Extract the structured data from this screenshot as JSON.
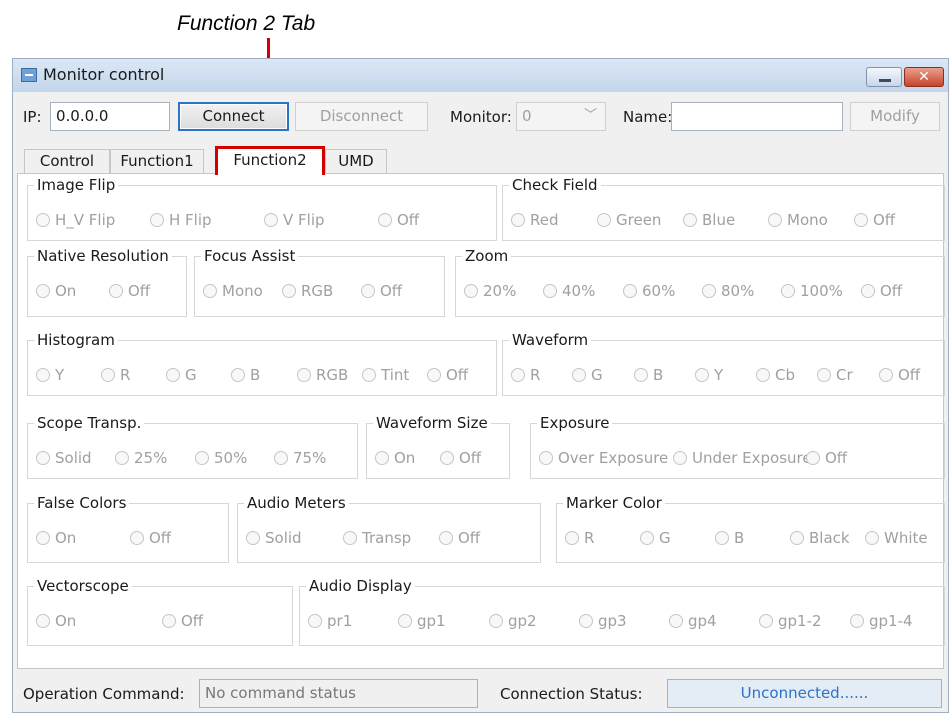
{
  "annotation": {
    "label": "Function 2 Tab"
  },
  "window": {
    "title": "Monitor control",
    "close_glyph": "✕"
  },
  "toolbar": {
    "ip_label": "IP:",
    "ip_value": "0.0.0.0",
    "connect_label": "Connect",
    "disconnect_label": "Disconnect",
    "monitor_label": "Monitor:",
    "monitor_value": "0",
    "name_label": "Name:",
    "name_value": "",
    "modify_label": "Modify"
  },
  "tabs": [
    "Control",
    "Function1",
    "Function2",
    "UMD"
  ],
  "active_tab": "Function2",
  "groups": [
    {
      "id": "image-flip",
      "label": "Image Flip",
      "options": [
        "H_V Flip",
        "H Flip",
        "V Flip",
        "Off"
      ]
    },
    {
      "id": "check-field",
      "label": "Check Field",
      "options": [
        "Red",
        "Green",
        "Blue",
        "Mono",
        "Off"
      ]
    },
    {
      "id": "native-resolution",
      "label": "Native Resolution",
      "options": [
        "On",
        "Off"
      ]
    },
    {
      "id": "focus-assist",
      "label": "Focus Assist",
      "options": [
        "Mono",
        "RGB",
        "Off"
      ]
    },
    {
      "id": "zoom",
      "label": "Zoom",
      "options": [
        "20%",
        "40%",
        "60%",
        "80%",
        "100%",
        "Off"
      ]
    },
    {
      "id": "histogram",
      "label": "Histogram",
      "options": [
        "Y",
        "R",
        "G",
        "B",
        "RGB",
        "Tint",
        "Off"
      ]
    },
    {
      "id": "waveform",
      "label": "Waveform",
      "options": [
        "R",
        "G",
        "B",
        "Y",
        "Cb",
        "Cr",
        "Off"
      ]
    },
    {
      "id": "scope-transp",
      "label": "Scope Transp.",
      "options": [
        "Solid",
        "25%",
        "50%",
        "75%"
      ]
    },
    {
      "id": "waveform-size",
      "label": "Waveform Size",
      "options": [
        "On",
        "Off"
      ]
    },
    {
      "id": "exposure",
      "label": "Exposure",
      "options": [
        "Over Exposure",
        "Under Exposure",
        "Off"
      ]
    },
    {
      "id": "false-colors",
      "label": "False Colors",
      "options": [
        "On",
        "Off"
      ]
    },
    {
      "id": "audio-meters",
      "label": "Audio Meters",
      "options": [
        "Solid",
        "Transp",
        "Off"
      ]
    },
    {
      "id": "marker-color",
      "label": "Marker Color",
      "options": [
        "R",
        "G",
        "B",
        "Black",
        "White"
      ]
    },
    {
      "id": "vectorscope",
      "label": "Vectorscope",
      "options": [
        "On",
        "Off"
      ]
    },
    {
      "id": "audio-display",
      "label": "Audio Display",
      "options": [
        "pr1",
        "gp1",
        "gp2",
        "gp3",
        "gp4",
        "gp1-2",
        "gp1-4"
      ]
    }
  ],
  "status": {
    "operation_label": "Operation Command:",
    "operation_value": "No command status",
    "connection_label": "Connection Status:",
    "connection_value": "Unconnected......"
  },
  "colors": {
    "highlight": "#d40000",
    "status_text": "#2a73c8",
    "disabled_text": "#a0a0a0"
  }
}
